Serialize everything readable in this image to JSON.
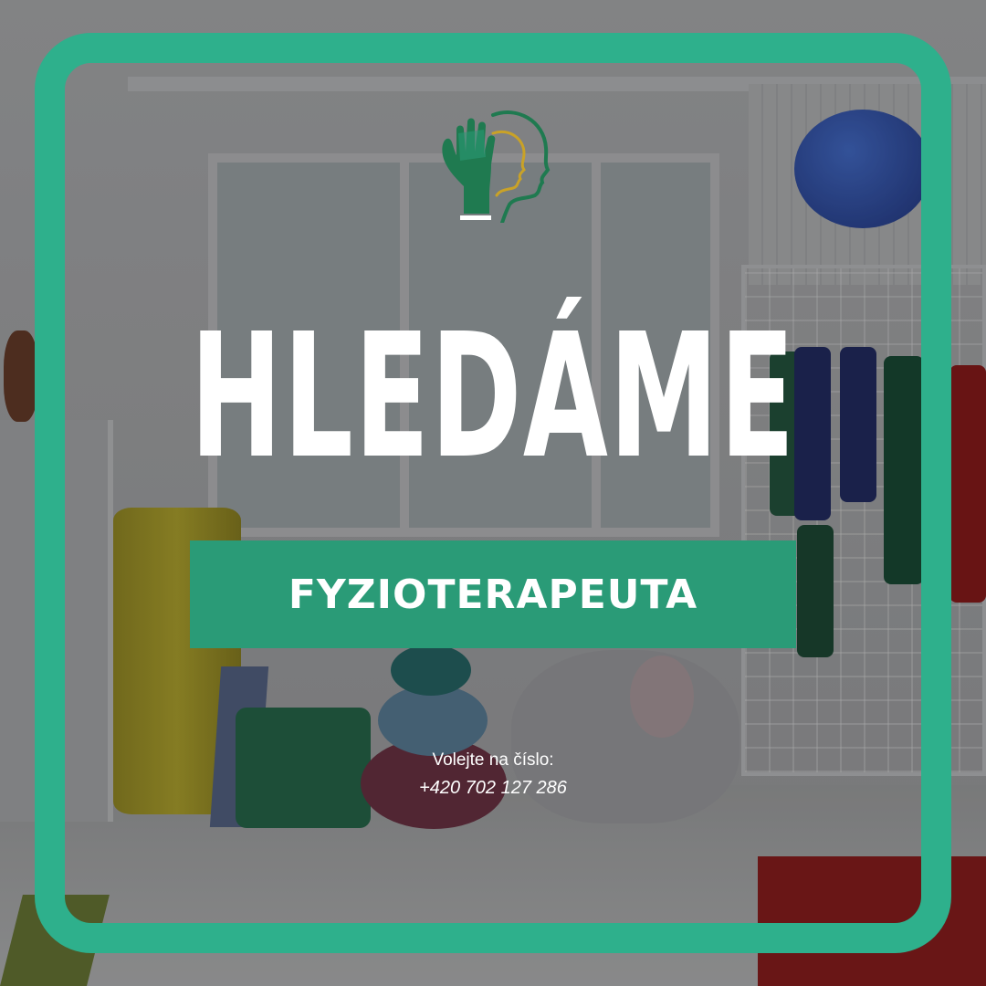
{
  "poster": {
    "headline": "HLEDÁME",
    "position": "FYZIOTERAPEUTA",
    "contact_label": "Volejte na číslo:",
    "contact_phone": "+420 702 127 286"
  },
  "colors": {
    "frame": "#2eb08c",
    "banner": "#2a9b77",
    "text": "#ffffff",
    "logo_green": "#1f7a50",
    "logo_gold": "#c9a227"
  },
  "icons": {
    "logo": "hand-and-head-profile-logo"
  }
}
